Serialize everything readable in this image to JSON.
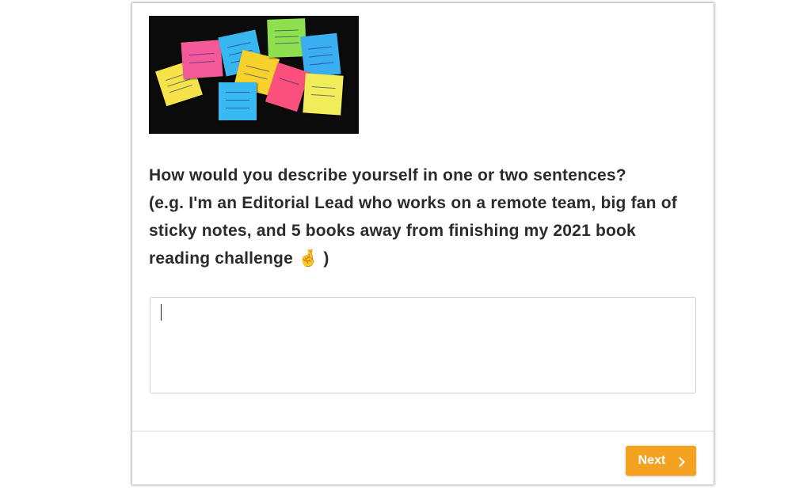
{
  "survey": {
    "question_line1": "How would you describe yourself in one or two sentences?",
    "question_rest": "(e.g. I'm an Editorial Lead who works on a remote team, big fan of sticky notes, and 5 books away from finishing my 2021 book reading challenge",
    "question_emoji": "🤞",
    "question_end": ")",
    "answer_value": "",
    "next_label": "Next"
  },
  "image": {
    "subject": "sticky notes on a dark background",
    "note_colors": [
      "#f6e34a",
      "#f45a9a",
      "#38b6f0",
      "#f7d22d",
      "#8fe04f",
      "#3aaef0",
      "#38b9f2",
      "#fb4f7d",
      "#f1ec5a"
    ]
  },
  "theme": {
    "accent": "#f4a21f",
    "text": "#2b2b2b",
    "border": "#cfcfcf"
  }
}
